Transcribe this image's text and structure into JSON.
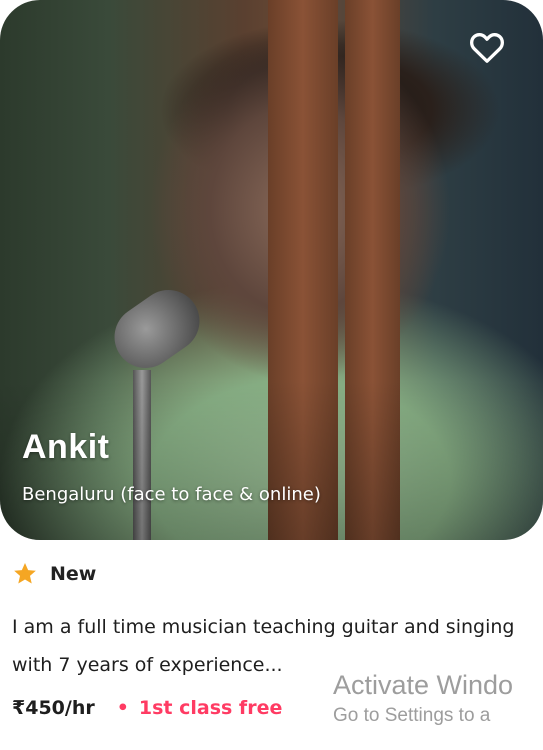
{
  "teacher": {
    "name": "Ankit",
    "location": "Bengaluru (face to face & online)",
    "rating_label": "New",
    "description": "I am a full time musician teaching guitar and singing with 7 years of experience...",
    "price": "₹450/hr",
    "separator": "•",
    "offer": "1st class free"
  },
  "icons": {
    "favorite": "heart-outline-icon",
    "rating": "star-icon"
  },
  "colors": {
    "accent": "#ff3b63",
    "star": "#f5a623",
    "text": "#1e1e1e"
  },
  "watermark": {
    "line1": "Activate Windo",
    "line2": "Go to Settings to a"
  }
}
